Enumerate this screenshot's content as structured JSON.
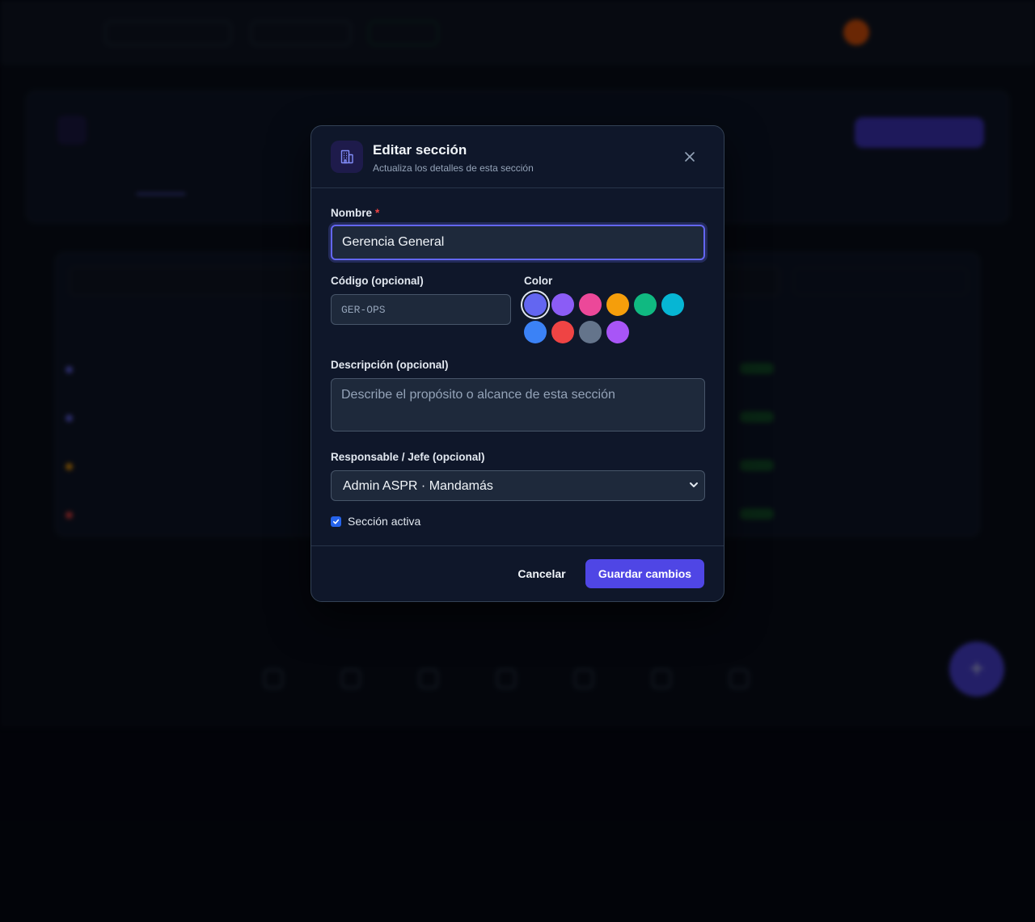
{
  "modal": {
    "title": "Editar sección",
    "subtitle": "Actualiza los detalles de esta sección",
    "icon": "building-icon",
    "close_icon": "close-icon",
    "nombre": {
      "label": "Nombre",
      "required_mark": "*",
      "value": "Gerencia General"
    },
    "codigo": {
      "label": "Código (opcional)",
      "placeholder": "GER-OPS",
      "value": ""
    },
    "color": {
      "label": "Color",
      "selected": "#6366f1",
      "options": [
        "#6366f1",
        "#8b5cf6",
        "#ec4899",
        "#f59e0b",
        "#10b981",
        "#06b6d4",
        "#3b82f6",
        "#ef4444",
        "#64748b",
        "#a855f7"
      ]
    },
    "descripcion": {
      "label": "Descripción (opcional)",
      "placeholder": "Describe el propósito o alcance de esta sección",
      "value": ""
    },
    "responsable": {
      "label": "Responsable / Jefe (opcional)",
      "selected": "Admin ASPR · Mandamás"
    },
    "activa": {
      "label": "Sección activa",
      "checked": true
    },
    "cancel_label": "Cancelar",
    "save_label": "Guardar cambios"
  },
  "colors": {
    "accent": "#4f46e5",
    "focus_ring": "#6366f1",
    "modal_bg": "#0f172a",
    "required": "#ef4444"
  }
}
